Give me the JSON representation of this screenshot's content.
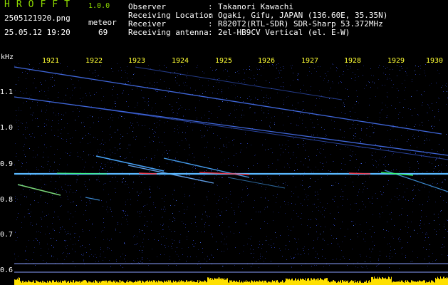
{
  "header": {
    "brand": "HROFFT",
    "version": "1.0.0",
    "filename": "2505121920.png",
    "datetime": "25.05.12 19:20",
    "meteor_label": "meteor",
    "meteor_count": "69"
  },
  "info": [
    {
      "label": "Observer",
      "value": "Takanori Kawachi"
    },
    {
      "label": "Receiving Location",
      "value": "Ogaki, Gifu, JAPAN (136.60E, 35.35N)"
    },
    {
      "label": "Receiver",
      "value": "R820T2(RTL-SDR) SDR-Sharp 53.372MHz"
    },
    {
      "label": "Receiving antenna",
      "value": "2el-HB9CV Vertical (el. E-W)"
    }
  ],
  "axis": {
    "y_unit": "kHz",
    "y_ticks": [
      "1.1",
      "1.0",
      "0.9",
      "0.8",
      "0.7",
      "0.6"
    ],
    "x_ticks": [
      "1921",
      "1922",
      "1923",
      "1924",
      "1925",
      "1926",
      "1927",
      "1928",
      "1929",
      "1930"
    ]
  },
  "colors": {
    "background": "#000000",
    "noise": "#1a2a7a",
    "trace": "#4aa8ff",
    "carrier_hot": "#ff3344",
    "carrier_warm": "#33ff66",
    "bars": "#ffe000",
    "brand": "#8fdc00",
    "tick_labels": "#ffff33"
  }
}
